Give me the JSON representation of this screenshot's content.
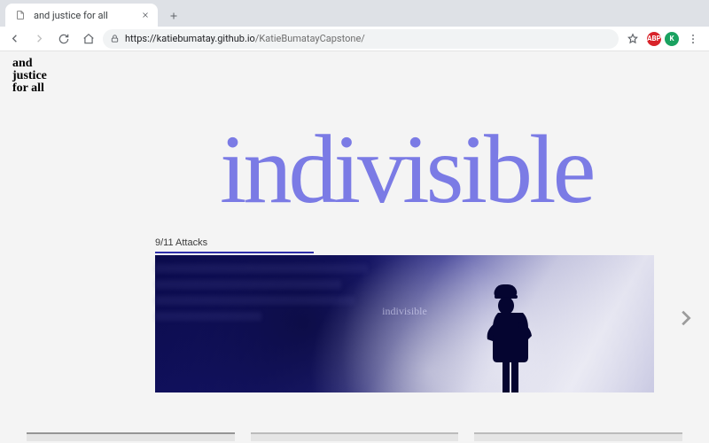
{
  "browser": {
    "tab_title": "and justice for all",
    "url_host": "https://katiebumatay.github.io",
    "url_path": "/KatieBumatayCapstone/",
    "abp_label": "ABP",
    "avatar_initial": "K"
  },
  "page": {
    "logo_line1": "and",
    "logo_line2": "justice",
    "logo_line3": "for all",
    "headline": "indivisible",
    "caption": "9/11 Attacks",
    "hero_subtext": "indivisible"
  }
}
